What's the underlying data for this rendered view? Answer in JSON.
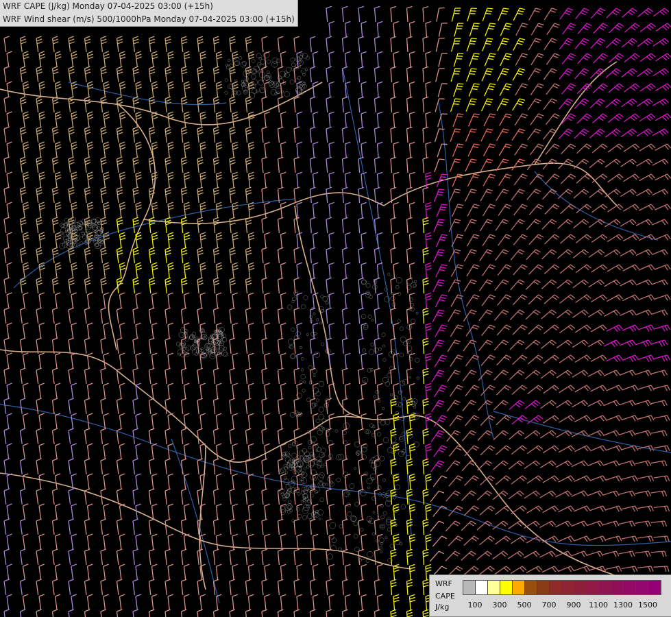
{
  "header": {
    "line1": "WRF CAPE (J/kg) Monday 07-04-2025 03:00 (+15h)",
    "line2": "WRF Wind shear (m/s) 500/1000hPa Monday 07-04-2025 03:00 (+15h)"
  },
  "legend": {
    "label_line1": "WRF",
    "label_line2": "CAPE",
    "unit": "J/kg",
    "colors": [
      "#b8b8b8",
      "#ffffff",
      "#ffff99",
      "#ffff00",
      "#ffaa00",
      "#9b4f0f",
      "#8a3b15",
      "#8e2a2a",
      "#8f2434",
      "#8f1e3c",
      "#901946",
      "#90144f",
      "#910f58",
      "#920a63",
      "#93066b",
      "#940073"
    ],
    "ticks": [
      "100",
      "300",
      "500",
      "700",
      "900",
      "1100",
      "1300",
      "1500"
    ]
  },
  "barb_colors": {
    "tan": "#c9a86f",
    "pink": "#d9928a",
    "lilac": "#a98ad8",
    "yellow": "#f4f200",
    "salmon": "#ea6c5c",
    "magenta": "#d816c8",
    "rose": "#c07070"
  },
  "map_colors": {
    "borders": "#d8b08c",
    "rivers": "#2f5fa8",
    "contours": "#e0e0e0"
  }
}
